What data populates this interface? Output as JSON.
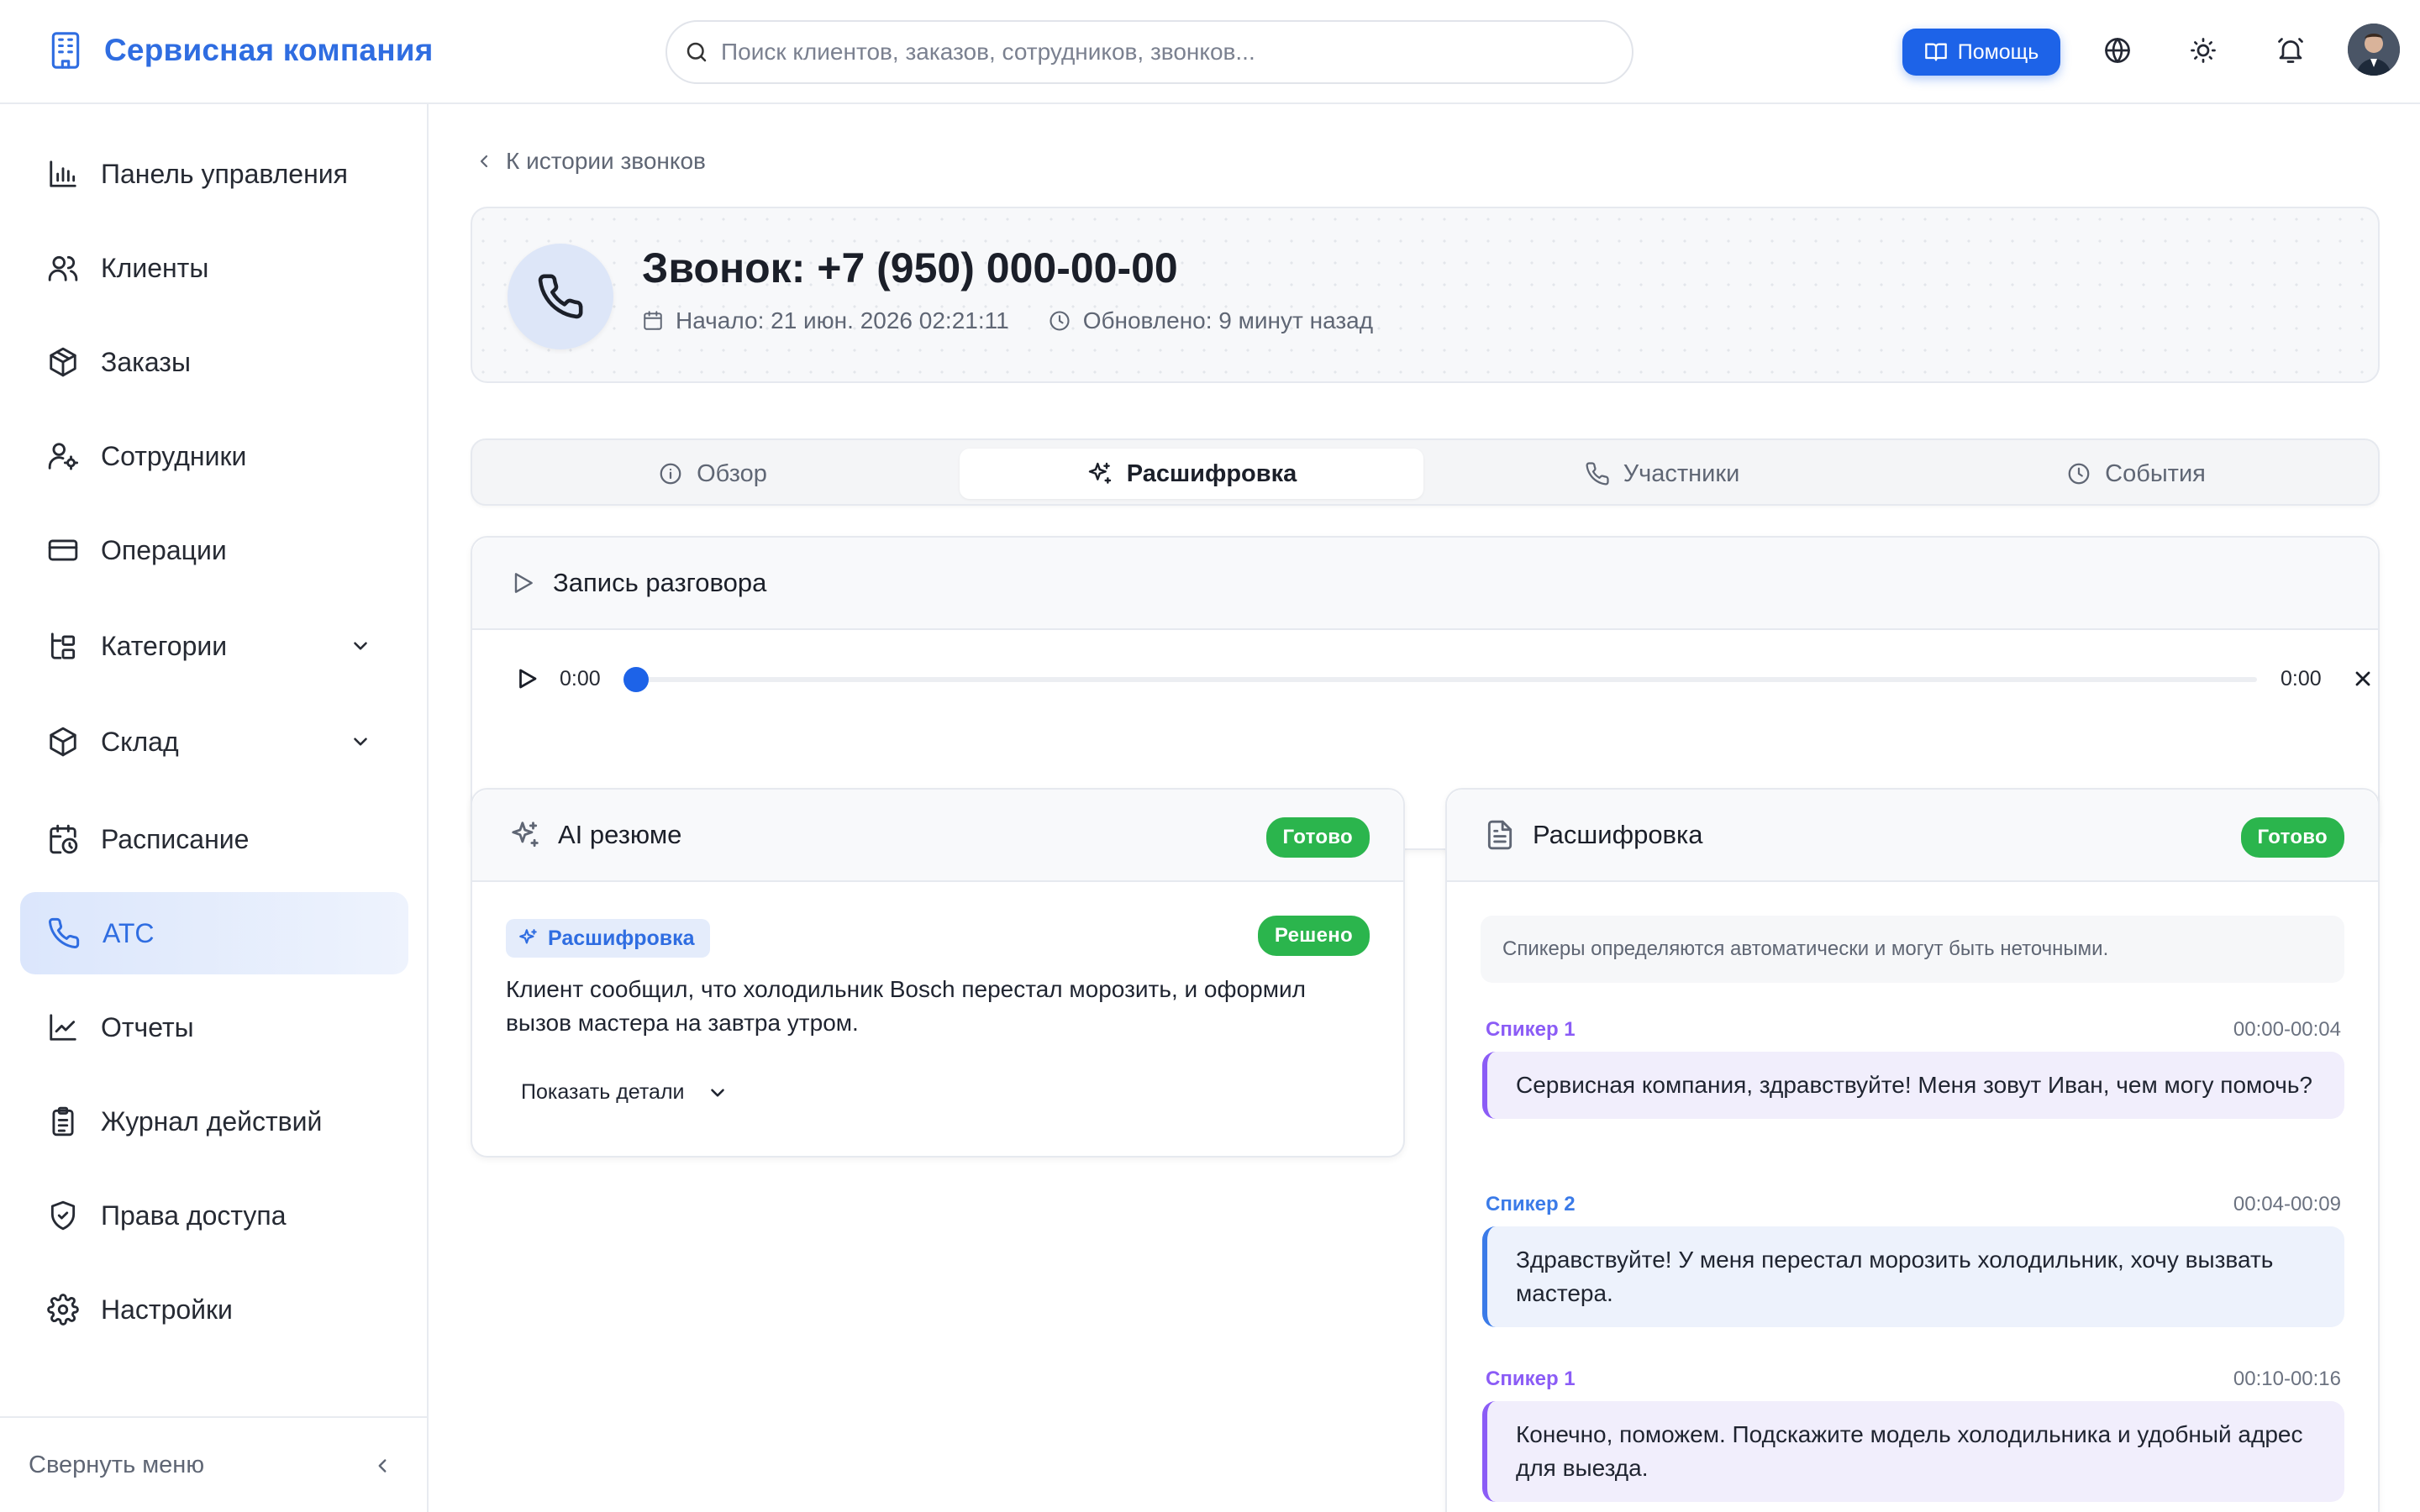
{
  "app": {
    "brand": "Сервисная компания"
  },
  "header": {
    "search_placeholder": "Поиск клиентов, заказов, сотрудников, звонков...",
    "help_label": "Помощь"
  },
  "sidebar": {
    "items": [
      {
        "label": "Панель управления",
        "icon": "bar-chart-icon"
      },
      {
        "label": "Клиенты",
        "icon": "users-icon"
      },
      {
        "label": "Заказы",
        "icon": "box-icon"
      },
      {
        "label": "Сотрудники",
        "icon": "user-cog-icon"
      },
      {
        "label": "Операции",
        "icon": "credit-card-icon"
      },
      {
        "label": "Категории",
        "icon": "tree-icon"
      },
      {
        "label": "Склад",
        "icon": "package-icon"
      },
      {
        "label": "Расписание",
        "icon": "calendar-clock-icon"
      },
      {
        "label": "АТС",
        "icon": "phone-icon"
      },
      {
        "label": "Отчеты",
        "icon": "line-chart-icon"
      },
      {
        "label": "Журнал действий",
        "icon": "clipboard-icon"
      },
      {
        "label": "Права доступа",
        "icon": "shield-icon"
      },
      {
        "label": "Настройки",
        "icon": "gear-icon"
      }
    ],
    "active": "АТС",
    "collapse_label": "Свернуть меню"
  },
  "main": {
    "back_label": "К истории звонков",
    "call": {
      "title": "Звонок: +7 (950) 000-00-00",
      "started": "Начало: 21 июн. 2026 02:21:11",
      "updated": "Обновлено: 9 минут назад"
    },
    "tabs": [
      {
        "label": "Обзор"
      },
      {
        "label": "Расшифровка"
      },
      {
        "label": "Участники"
      },
      {
        "label": "События"
      }
    ],
    "active_tab": "Расшифровка",
    "recording": {
      "title": "Запись разговора",
      "current_time": "0:00",
      "duration": "0:00",
      "progress": 0
    },
    "ai_summary": {
      "title": "AI резюме",
      "status": "Готово",
      "source_chip": "Расшифровка",
      "resolution": "Решено",
      "text": "Клиент сообщил, что холодильник Bosch перестал морозить, и оформил вызов мастера на завтра утром.",
      "details_label": "Показать детали"
    },
    "transcript": {
      "title": "Расшифровка",
      "status": "Готово",
      "note": "Спикеры определяются автоматически и могут быть неточными.",
      "segments": [
        {
          "speaker": "Спикер 1",
          "time": "00:00-00:04",
          "text": "Сервисная компания, здравствуйте! Меня зовут Иван, чем могу помочь?"
        },
        {
          "speaker": "Спикер 2",
          "time": "00:04-00:09",
          "text": "Здравствуйте! У меня перестал морозить холодильник, хочу вызвать мастера."
        },
        {
          "speaker": "Спикер 1",
          "time": "00:10-00:16",
          "text": "Конечно, поможем. Подскажите модель холодильника и удобный адрес для выезда."
        }
      ]
    }
  },
  "colors": {
    "accent": "#2f6de1",
    "primary_button": "#1d63e8",
    "success": "#2bb54d",
    "speaker1": "#8b5cf6",
    "speaker2": "#3b7be8"
  }
}
